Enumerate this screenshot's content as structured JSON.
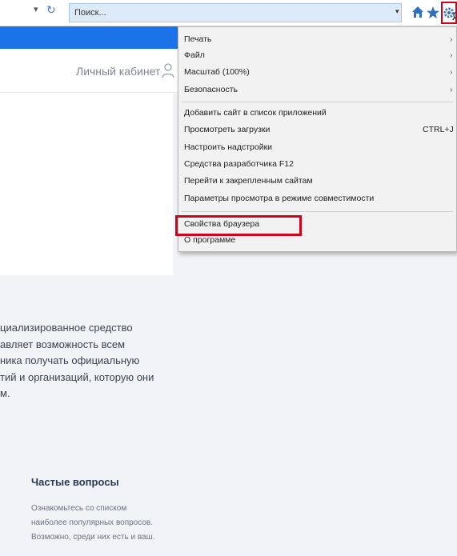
{
  "toolbar": {
    "address_dropdown": "▾",
    "refresh_glyph": "↻",
    "search_placeholder": "Поиск...",
    "search_dropdown": "▾",
    "accent_color": "#1a73e8",
    "highlight_color": "#d0021b",
    "icons": [
      "refresh-icon",
      "search-icon",
      "home-icon",
      "star-icon",
      "gear-icon"
    ]
  },
  "header": {
    "cabinet_label": "Личный кабинет"
  },
  "body": {
    "description_lines": [
      "циализированное средство",
      "авляет возможность всем",
      "ника получать официальную",
      "тий и организаций, которую они",
      "м."
    ],
    "faq_title": "Частые вопросы",
    "faq_lines": [
      "Ознакомьтесь со списком",
      "наиболее популярных вопросов.",
      "Возможно, среди них есть и ваш."
    ]
  },
  "menu": {
    "items": [
      {
        "label": "Печать",
        "submenu": "›"
      },
      {
        "label": "Файл",
        "submenu": "›"
      },
      {
        "label": "Масштаб (100%)",
        "submenu": "›"
      },
      {
        "label": "Безопасность",
        "submenu": "›"
      },
      {
        "label": "Добавить сайт в список приложений"
      },
      {
        "label": "Просмотреть загрузки",
        "shortcut": "CTRL+J"
      },
      {
        "label": "Настроить надстройки"
      },
      {
        "label": "Средства разработчика F12"
      },
      {
        "label": "Перейти к закрепленным сайтам"
      },
      {
        "label": "Параметры просмотра в режиме совместимости"
      },
      {
        "label": "Свойства браузера"
      },
      {
        "label": "О программе"
      }
    ]
  }
}
